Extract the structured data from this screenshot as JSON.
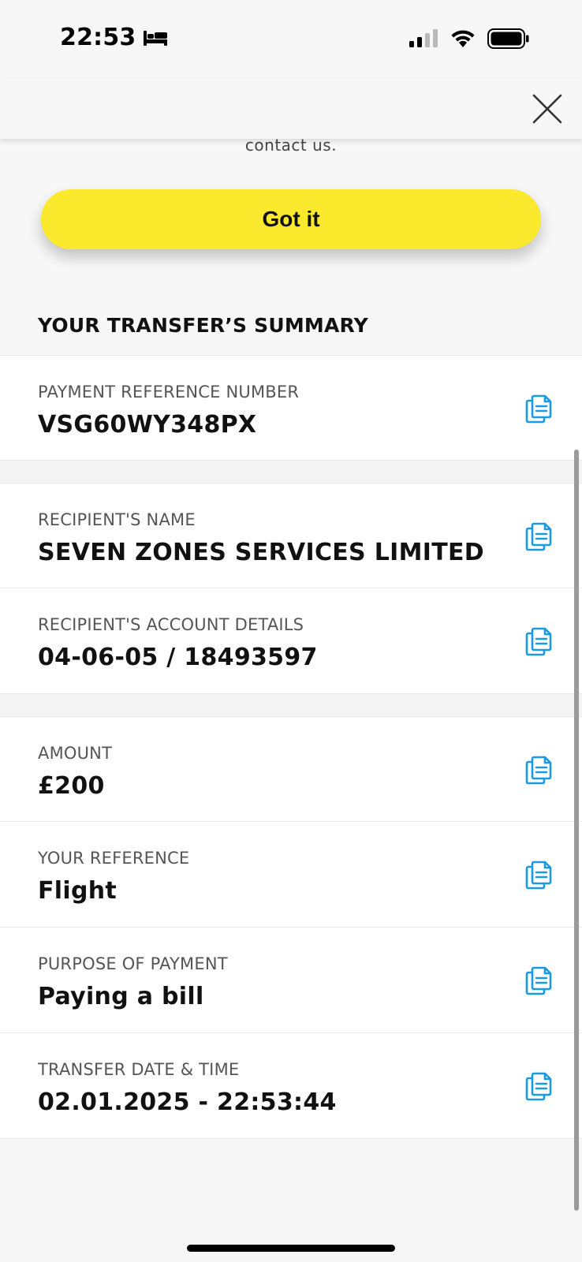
{
  "status_bar": {
    "time": "22:53",
    "focus_icon": "bed-icon",
    "signal_icon": "cellular-signal-icon",
    "wifi_icon": "wifi-icon",
    "battery_icon": "battery-icon"
  },
  "header": {
    "close_icon": "close-icon"
  },
  "notice": {
    "text": "contact us."
  },
  "got_it_label": "Got it",
  "summary": {
    "title": "YOUR TRANSFER’S SUMMARY",
    "payment_reference": {
      "label": "PAYMENT REFERENCE NUMBER",
      "value": "VSG60WY348PX"
    },
    "recipient_name": {
      "label": "RECIPIENT'S NAME",
      "value": "SEVEN ZONES SERVICES LIMITED"
    },
    "recipient_account": {
      "label": "RECIPIENT'S ACCOUNT DETAILS",
      "value": "04-06-05 / 18493597"
    },
    "amount": {
      "label": "AMOUNT",
      "value": "£200"
    },
    "your_reference": {
      "label": "YOUR REFERENCE",
      "value": "Flight"
    },
    "purpose": {
      "label": "PURPOSE OF PAYMENT",
      "value": "Paying a bill"
    },
    "transfer_datetime": {
      "label": "TRANSFER DATE & TIME",
      "value": "02.01.2025 - 22:53:44"
    }
  },
  "colors": {
    "accent_yellow": "#fbe92e",
    "copy_icon_blue": "#1a9ae0"
  }
}
